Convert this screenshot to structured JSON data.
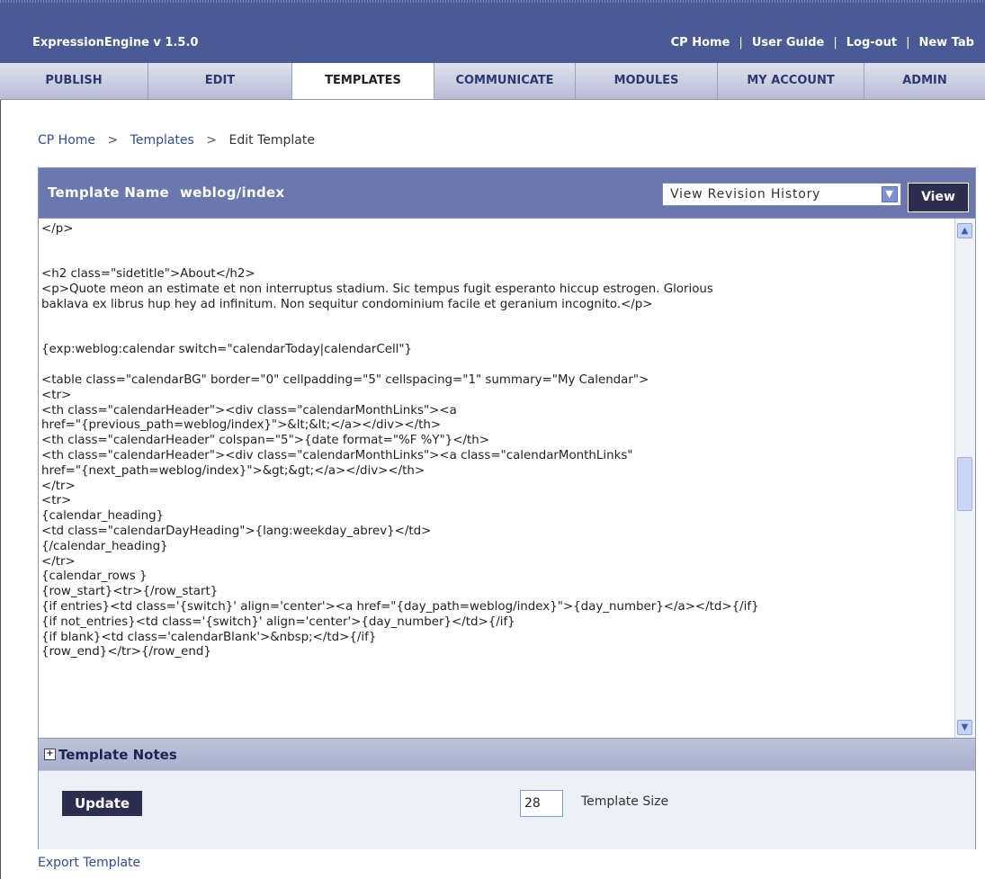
{
  "header": {
    "app_name": "ExpressionEngine  v 1.5.0",
    "links": [
      "CP Home",
      "User Guide",
      "Log-out",
      "New Tab"
    ],
    "separator": "|"
  },
  "tabs": [
    {
      "label": "PUBLISH",
      "active": false
    },
    {
      "label": "EDIT",
      "active": false
    },
    {
      "label": "TEMPLATES",
      "active": true
    },
    {
      "label": "COMMUNICATE",
      "active": false
    },
    {
      "label": "MODULES",
      "active": false
    },
    {
      "label": "MY ACCOUNT",
      "active": false
    },
    {
      "label": "ADMIN",
      "active": false
    }
  ],
  "breadcrumb": {
    "items": [
      "CP Home",
      "Templates",
      "Edit Template"
    ],
    "separator": ">"
  },
  "template": {
    "name_label": "Template Name",
    "name_value": "weblog/index",
    "revision_select": "View Revision History",
    "view_button": "View",
    "code": "</p>\n\n\n<h2 class=\"sidetitle\">About</h2>\n<p>Quote meon an estimate et non interruptus stadium. Sic tempus fugit esperanto hiccup estrogen. Glorious\nbaklava ex librus hup hey ad infinitum. Non sequitur condominium facile et geranium incognito.</p>\n\n\n{exp:weblog:calendar switch=\"calendarToday|calendarCell\"}\n\n<table class=\"calendarBG\" border=\"0\" cellpadding=\"5\" cellspacing=\"1\" summary=\"My Calendar\">\n<tr>\n<th class=\"calendarHeader\"><div class=\"calendarMonthLinks\"><a\nhref=\"{previous_path=weblog/index}\">&lt;&lt;</a></div></th>\n<th class=\"calendarHeader\" colspan=\"5\">{date format=\"%F %Y\"}</th>\n<th class=\"calendarHeader\"><div class=\"calendarMonthLinks\"><a class=\"calendarMonthLinks\"\nhref=\"{next_path=weblog/index}\">&gt;&gt;</a></div></th>\n</tr>\n<tr>\n{calendar_heading}\n<td class=\"calendarDayHeading\">{lang:weekday_abrev}</td>\n{/calendar_heading}\n</tr>\n{calendar_rows }\n{row_start}<tr>{/row_start}\n{if entries}<td class='{switch}' align='center'><a href=\"{day_path=weblog/index}\">{day_number}</a></td>{/if}\n{if not_entries}<td class='{switch}' align='center'>{day_number}</td>{/if}\n{if blank}<td class='calendarBlank'>&nbsp;</td>{/if}\n{row_end}</tr>{/row_end}",
    "notes_label": "Template Notes",
    "update_button": "Update",
    "size_value": "28",
    "size_label": "Template Size",
    "export_link": "Export Template"
  },
  "colors": {
    "header_bg": "#4a5a96",
    "panel_head_bg": "#6b78b0",
    "button_bg": "#2b2e4f",
    "link": "#2e4b9b"
  }
}
